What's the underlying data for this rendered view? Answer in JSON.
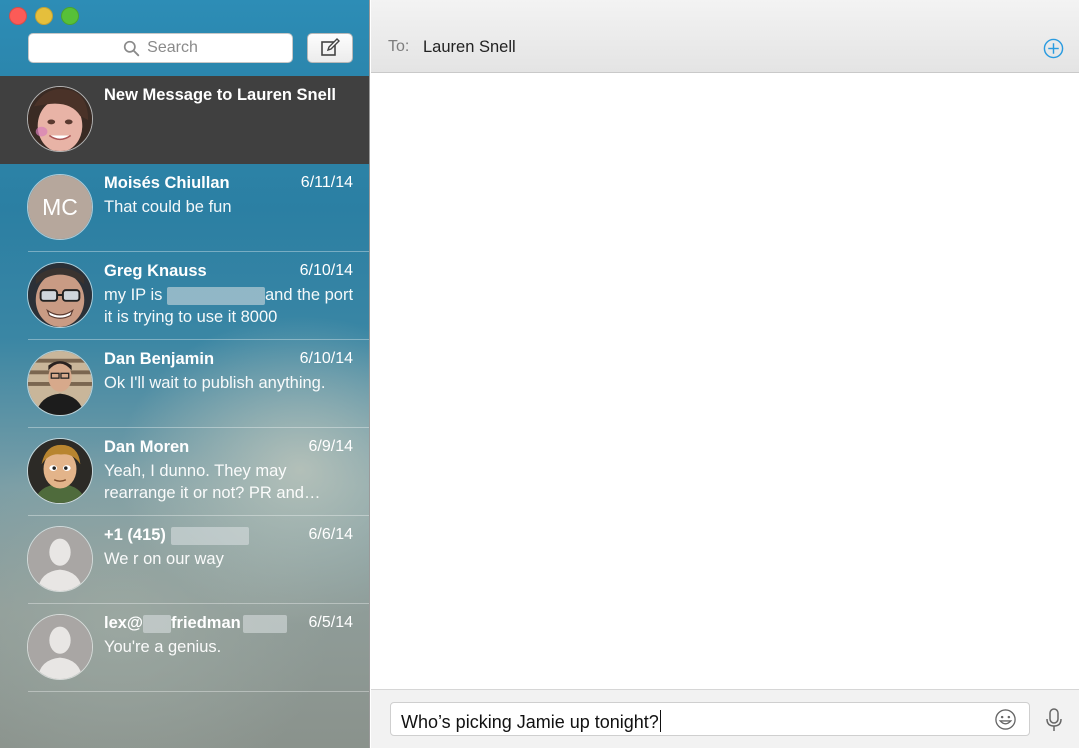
{
  "window": {
    "controls": [
      "close",
      "minimize",
      "zoom"
    ]
  },
  "sidebar": {
    "search_placeholder": "Search",
    "search_icon": "search-icon",
    "compose_icon": "compose-icon",
    "conversations": [
      {
        "name": "New Message to Lauren Snell",
        "date": "",
        "preview": "",
        "selected": true,
        "avatar": "photo"
      },
      {
        "name": "Moisés Chiullan",
        "date": "6/11/14",
        "preview": "That could be fun",
        "avatar_initials": "MC"
      },
      {
        "name": "Greg Knauss",
        "date": "6/10/14",
        "preview_part1": "my IP is",
        "preview_part2": "and the port it is trying to use it 8000",
        "avatar": "photo"
      },
      {
        "name": "Dan Benjamin",
        "date": "6/10/14",
        "preview": "Ok I'll wait to publish anything.",
        "avatar": "photo"
      },
      {
        "name": "Dan Moren",
        "date": "6/9/14",
        "preview": "Yeah, I dunno. They may rearrange it or not? PR and…",
        "avatar": "cartoon"
      },
      {
        "name_part1": "+1 (415)",
        "date": "6/6/14",
        "preview": "We r on our way",
        "avatar": "silhouette"
      },
      {
        "name_part1": "lex@",
        "name_part2": "friedman",
        "date": "6/5/14",
        "preview": "You're a genius.",
        "avatar": "silhouette"
      }
    ]
  },
  "main": {
    "to_label": "To:",
    "recipient": "Lauren Snell",
    "add_icon": "add-recipient-icon",
    "message_input_value": "Who’s picking Jamie up tonight?",
    "emoji_icon": "emoji-icon",
    "mic_icon": "microphone-icon"
  },
  "colors": {
    "accent": "#2a9be0",
    "selected_row": "#404040",
    "sidebar_top": "#2b86ad"
  }
}
